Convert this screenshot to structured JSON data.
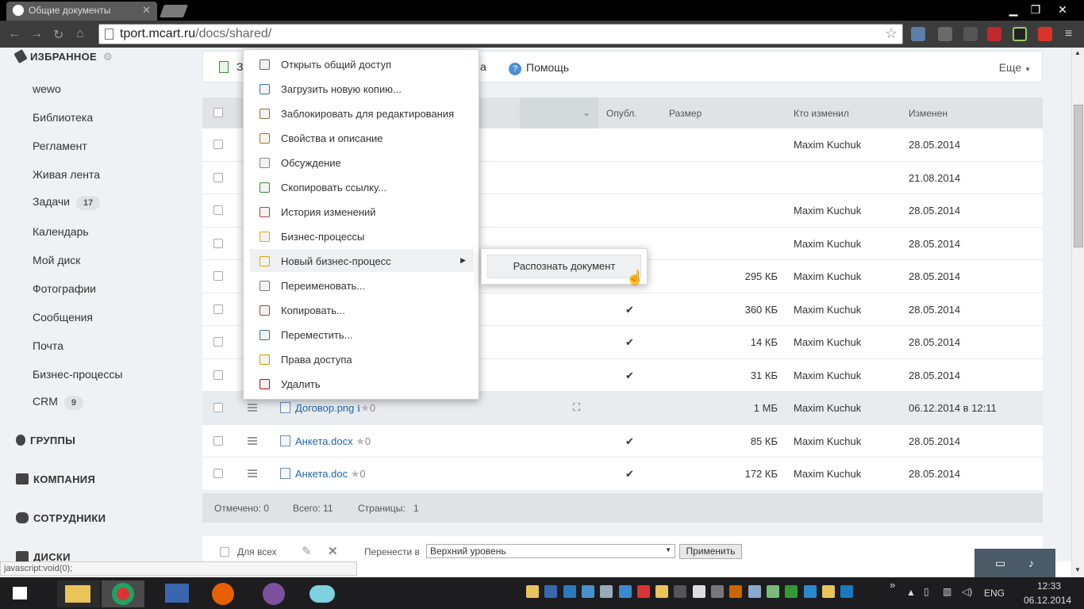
{
  "browser": {
    "tab_title": "Общие документы",
    "url_host": "tport.mcart.ru",
    "url_path": "/docs/shared/",
    "status_text": "javascript:void(0);"
  },
  "sidebar": {
    "favorites_label": "ИЗБРАННОЕ",
    "items": [
      {
        "label": "wewo"
      },
      {
        "label": "Библиотека"
      },
      {
        "label": "Регламент"
      },
      {
        "label": "Живая лента"
      },
      {
        "label": "Задачи",
        "count": "17"
      },
      {
        "label": "Календарь"
      },
      {
        "label": "Мой диск"
      },
      {
        "label": "Фотографии"
      },
      {
        "label": "Сообщения"
      },
      {
        "label": "Почта"
      },
      {
        "label": "Бизнес-процессы"
      },
      {
        "label": "CRM",
        "count": "9"
      }
    ],
    "groups_label": "ГРУППЫ",
    "company_label": "КОМПАНИЯ",
    "employees_label": "СОТРУДНИКИ",
    "disks_label": "ДИСКИ"
  },
  "actionbar": {
    "first_btn_fragment": "З",
    "mid_fragment": "а",
    "help_label": "Помощь",
    "more_label": "Еще"
  },
  "table": {
    "headers": {
      "published": "Опубл.",
      "size": "Размер",
      "modified_by": "Кто изменил",
      "modified": "Изменен"
    },
    "rows": [
      {
        "name": "",
        "pub": "",
        "size": "",
        "by": "Maxim Kuchuk",
        "date": "28.05.2014"
      },
      {
        "name": "",
        "pub": "",
        "size": "",
        "by": "",
        "date": "21.08.2014"
      },
      {
        "name": "",
        "pub": "",
        "size": "",
        "by": "Maxim Kuchuk",
        "date": "28.05.2014"
      },
      {
        "name": "",
        "pub": "",
        "size": "",
        "by": "Maxim Kuchuk",
        "date": "28.05.2014"
      },
      {
        "name": "",
        "pub": "",
        "size": "295 КБ",
        "by": "Maxim Kuchuk",
        "date": "28.05.2014"
      },
      {
        "name": "",
        "pub": "✔",
        "size": "360 КБ",
        "by": "Maxim Kuchuk",
        "date": "28.05.2014"
      },
      {
        "name": "",
        "pub": "✔",
        "size": "14 КБ",
        "by": "Maxim Kuchuk",
        "date": "28.05.2014"
      },
      {
        "name": "",
        "pub": "✔",
        "size": "31 КБ",
        "by": "Maxim Kuchuk",
        "date": "28.05.2014"
      },
      {
        "name": "Договор.png",
        "stars": "0",
        "pub": "",
        "size": "1 МБ",
        "by": "Maxim Kuchuk",
        "date": "06.12.2014 в 12:11"
      },
      {
        "name": "Анкета.docx",
        "stars": "0",
        "pub": "✔",
        "size": "85 КБ",
        "by": "Maxim Kuchuk",
        "date": "28.05.2014"
      },
      {
        "name": "Анкета.doc",
        "stars": "0",
        "pub": "✔",
        "size": "172 КБ",
        "by": "Maxim Kuchuk",
        "date": "28.05.2014"
      }
    ]
  },
  "footer": {
    "marked": "Отмечено: 0",
    "total": "Всего: 11",
    "pages_label": "Страницы:",
    "page": "1"
  },
  "groupbar": {
    "for_all": "Для всех",
    "move_to": "Перенести в",
    "target": "Верхний уровень",
    "apply": "Применить"
  },
  "context_menu": {
    "items": [
      "Открыть общий доступ",
      "Загрузить новую копию...",
      "Заблокировать для редактирования",
      "Свойства и описание",
      "Обсуждение",
      "Скопировать ссылку...",
      "История изменений",
      "Бизнес-процессы",
      "Новый бизнес-процесс",
      "Переименовать...",
      "Копировать...",
      "Переместить...",
      "Права доступа",
      "Удалить"
    ],
    "submenu_item": "Распознать документ"
  },
  "taskbar": {
    "lang": "ENG",
    "time": "12:33",
    "date": "06.12.2014",
    "chevron": "»"
  },
  "colors": {
    "link": "#2066b0",
    "page_bg": "#eef2f4",
    "header_bg": "#dfe3e6"
  }
}
